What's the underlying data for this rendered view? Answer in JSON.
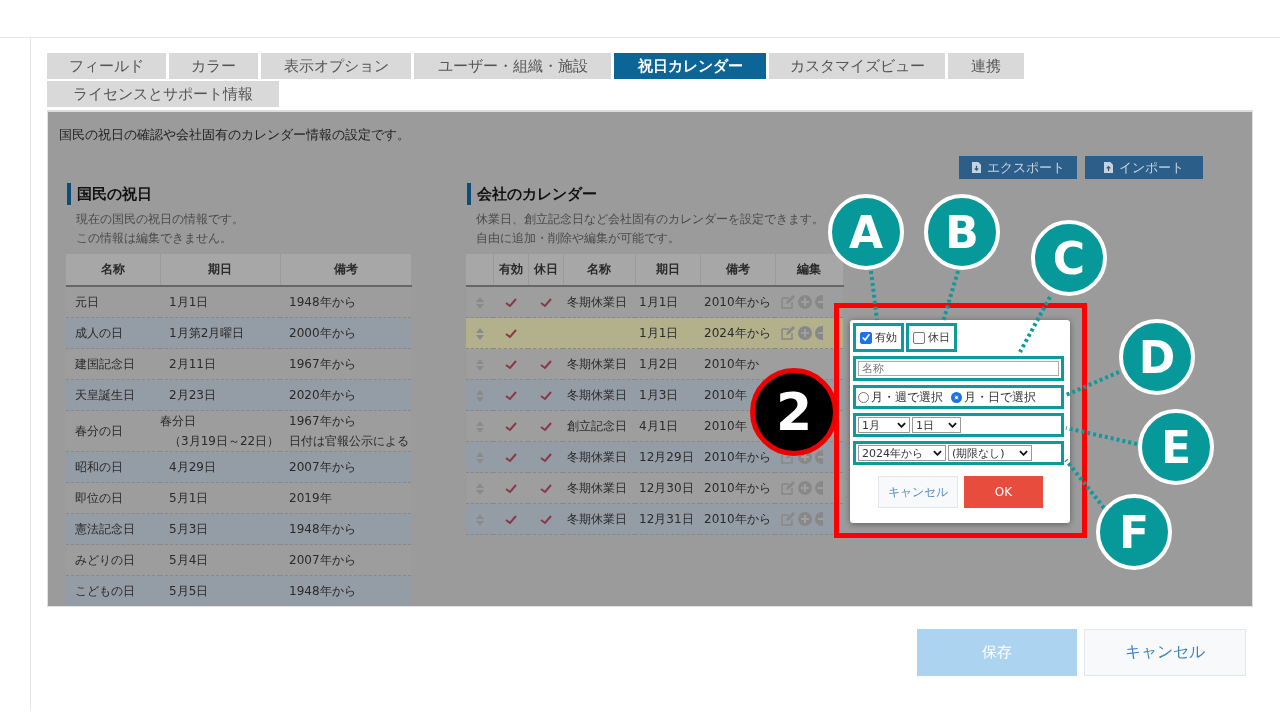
{
  "tabs": [
    {
      "label": "フィールド",
      "selected": false
    },
    {
      "label": "カラー",
      "selected": false
    },
    {
      "label": "表示オプション",
      "selected": false
    },
    {
      "label": "ユーザー・組織・施設",
      "selected": false
    },
    {
      "label": "祝日カレンダー",
      "selected": true
    },
    {
      "label": "カスタマイズビュー",
      "selected": false
    },
    {
      "label": "連携",
      "selected": false
    },
    {
      "label": "ライセンスとサポート情報",
      "selected": false
    }
  ],
  "description": "国民の祝日の確認や会社固有のカレンダー情報の設定です。",
  "toolbar": {
    "export": "エクスポート",
    "import": "インポート"
  },
  "national_holidays": {
    "title": "国民の祝日",
    "notes": [
      "現在の国民の祝日の情報です。",
      "この情報は編集できません。"
    ],
    "columns": [
      "名称",
      "期日",
      "備考"
    ],
    "rows": [
      [
        "元日",
        "1月1日",
        "1948年から"
      ],
      [
        "成人の日",
        "1月第2月曜日",
        "2000年から"
      ],
      [
        "建国記念日",
        "2月11日",
        "1967年から"
      ],
      [
        "天皇誕生日",
        "2月23日",
        "2020年から"
      ],
      [
        "春分の日",
        [
          "春分日",
          "（3月19日～22日）"
        ],
        [
          "1967年から",
          "日付は官報公示による"
        ]
      ],
      [
        "昭和の日",
        "4月29日",
        "2007年から"
      ],
      [
        "即位の日",
        "5月1日",
        "2019年"
      ],
      [
        "憲法記念日",
        "5月3日",
        "1948年から"
      ],
      [
        "みどりの日",
        "5月4日",
        "2007年から"
      ],
      [
        "こどもの日",
        "5月5日",
        "1948年から"
      ]
    ]
  },
  "company_calendar": {
    "title": "会社のカレンダー",
    "notes": [
      "休業日、創立記念日など会社固有のカレンダーを設定できます。",
      "自由に追加・削除や編集が可能です。"
    ],
    "columns": [
      "有効",
      "休日",
      "名称",
      "期日",
      "備考",
      "編集"
    ],
    "rows": [
      {
        "enabled": true,
        "holiday": true,
        "name": "冬期休業日",
        "date": "1月1日",
        "note": "2010年から",
        "highlighted": false
      },
      {
        "enabled": true,
        "holiday": false,
        "date": "1月1日",
        "note": "2024年から",
        "highlighted": true
      },
      {
        "enabled": true,
        "holiday": true,
        "name": "冬期休業日",
        "date": "1月2日",
        "note": "2010年か",
        "highlighted": false
      },
      {
        "enabled": true,
        "holiday": true,
        "name": "冬期休業日",
        "date": "1月3日",
        "note": "2010年",
        "highlighted": false
      },
      {
        "enabled": true,
        "holiday": true,
        "name": "創立記念日",
        "date": "4月1日",
        "note": "2010年",
        "highlighted": false
      },
      {
        "enabled": true,
        "holiday": true,
        "name": "冬期休業日",
        "date": "12月29日",
        "note": "2010年から",
        "highlighted": false
      },
      {
        "enabled": true,
        "holiday": true,
        "name": "冬期休業日",
        "date": "12月30日",
        "note": "2010年から",
        "highlighted": false
      },
      {
        "enabled": true,
        "holiday": true,
        "name": "冬期休業日",
        "date": "12月31日",
        "note": "2010年から",
        "highlighted": false
      }
    ]
  },
  "dialog": {
    "enabled": {
      "label": "有効",
      "checked": true
    },
    "holiday": {
      "label": "休日",
      "checked": false
    },
    "name": {
      "placeholder": "名称"
    },
    "modes": [
      {
        "label": "月・週で選択",
        "selected": false
      },
      {
        "label": "月・日で選択",
        "selected": true
      }
    ],
    "month": "1月",
    "day": "1日",
    "start": "2024年から",
    "end": "(期限なし)",
    "cancel": "キャンセル",
    "ok": "OK"
  },
  "step": "2",
  "callouts": [
    "A",
    "B",
    "C",
    "D",
    "E",
    "F"
  ],
  "footer": {
    "save": "保存",
    "cancel": "キャンセル"
  }
}
